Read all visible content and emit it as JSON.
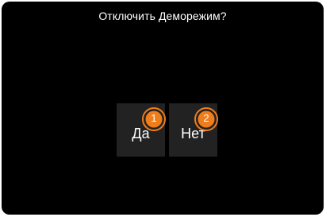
{
  "dialog": {
    "title": "Отключить Деморежим?",
    "buttons": [
      {
        "label": "Да",
        "badge": "1"
      },
      {
        "label": "Нет",
        "badge": "2"
      }
    ]
  },
  "colors": {
    "background": "#000000",
    "button": "#222222",
    "badge": "#f07d1c",
    "text": "#ffffff"
  }
}
